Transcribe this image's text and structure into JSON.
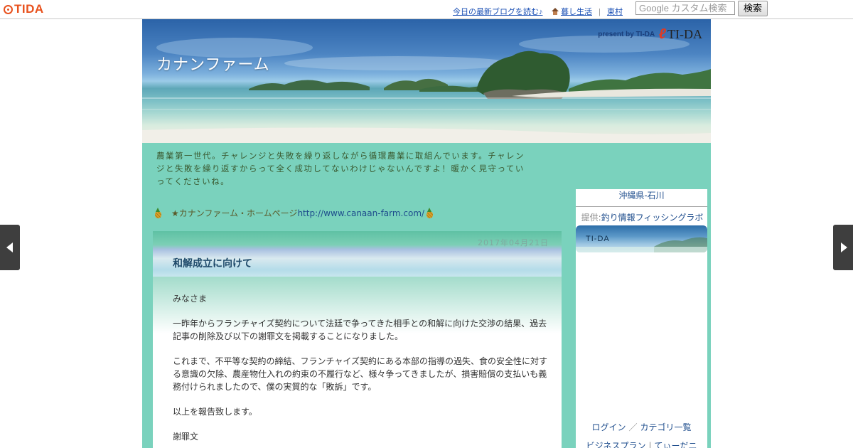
{
  "topbar": {
    "logo": "TIDA",
    "read_latest": "今日の最新ブログを読む♪",
    "lifestyle": "暮し生活",
    "village": "東村",
    "separator": "|",
    "search_placeholder": "Google カスタム検索",
    "search_button": "検索"
  },
  "header": {
    "title": "カナンファーム",
    "present_by": "present by TI-DA",
    "brand": "TI-DA",
    "description": "農業第一世代。チャレンジと失敗を繰り返しながら循環農業に取組んでいます。チャレンジと失敗を繰り返すからって全く成功してないわけじゃないんですよ！暖かく見守っていってくださいね。"
  },
  "homepage": {
    "label": "★カナンファーム・ホームページ",
    "url": "http://www.canaan-farm.com/"
  },
  "entry": {
    "date": "2017年04月21日",
    "title": "和解成立に向けて",
    "paragraphs": [
      "みなさま",
      "一昨年からフランチャイズ契約について法廷で争ってきた相手との和解に向けた交渉の結果、過去記事の削除及び以下の謝罪文を掲載することになりました。",
      "これまで、不平等な契約の締結、フランチャイズ契約にある本部の指導の過失、食の安全性に対する意識の欠除、農産物仕入れの約束の不履行など、様々争ってきましたが、損害賠償の支払いも義務付けられましたので、僕の実質的な「敗訴」です。",
      "以上を報告致します。",
      "謝罪文"
    ]
  },
  "sidebar": {
    "location": "沖縄県-石川",
    "provided_label": "提供:",
    "provider": "釣り情報フィッシングラボ",
    "tida_label": "TI-DA",
    "login": "ログイン",
    "slash": "／",
    "categories": "カテゴリ一覧",
    "business_plan": "ビジネスプラン",
    "pipe": "|",
    "tiidani": "てぃーだニ"
  },
  "colors": {
    "page_bg": "#7ad2bd",
    "link": "#1d4c8c",
    "logo": "#e8511d"
  }
}
